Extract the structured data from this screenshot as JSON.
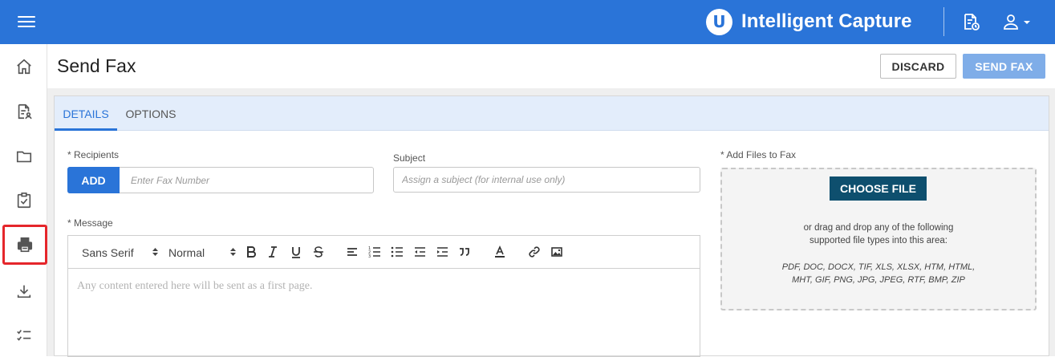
{
  "colors": {
    "brand_blue": "#2a74d8",
    "active_outline": "#e5262b",
    "choose_file_bg": "#0e4f6e",
    "send_fax_disabled": "#7fade8"
  },
  "topbar": {
    "brand_logo_letter": "U",
    "brand_name": "Intelligent Capture",
    "icons": [
      "menu-icon",
      "document-clock-icon",
      "user-icon",
      "caret-down-icon"
    ]
  },
  "sidebar": {
    "items": [
      {
        "icon": "home-icon",
        "active": false
      },
      {
        "icon": "document-user-icon",
        "active": false
      },
      {
        "icon": "folder-icon",
        "active": false
      },
      {
        "icon": "clipboard-check-icon",
        "active": false
      },
      {
        "icon": "fax-icon",
        "active": true
      },
      {
        "icon": "download-icon",
        "active": false
      },
      {
        "icon": "checklist-icon",
        "active": false
      }
    ]
  },
  "page": {
    "title": "Send Fax",
    "discard_label": "DISCARD",
    "send_fax_label": "SEND FAX"
  },
  "tabs": [
    {
      "label": "DETAILS",
      "active": true
    },
    {
      "label": "OPTIONS",
      "active": false
    }
  ],
  "form": {
    "recipients_label": "* Recipients",
    "add_label": "ADD",
    "fax_placeholder": "Enter Fax Number",
    "subject_label": "Subject",
    "subject_placeholder": "Assign a subject (for internal use only)",
    "message_label": "* Message",
    "font_select": "Sans Serif",
    "size_select": "Normal",
    "editor_placeholder": "Any content entered here will be sent as a first page."
  },
  "files": {
    "label": "* Add Files to Fax",
    "choose_file_label": "CHOOSE FILE",
    "drag_text_line1": "or drag and drop any of the following",
    "drag_text_line2": "supported file types into this area:",
    "types_line1": "PDF, DOC, DOCX, TIF, XLS, XLSX, HTM, HTML,",
    "types_line2": "MHT, GIF, PNG, JPG, JPEG, RTF, BMP, ZIP"
  }
}
